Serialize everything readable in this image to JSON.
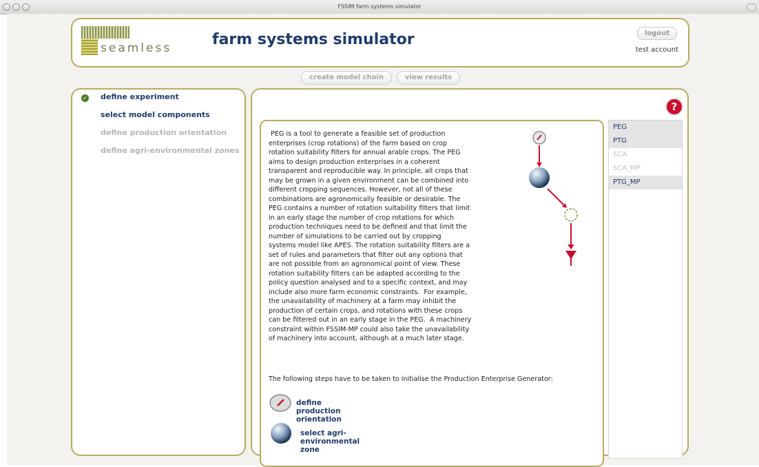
{
  "window": {
    "title": "FSSIM farm systems simulator"
  },
  "header": {
    "logo_text": "seamless",
    "app_title": "farm systems simulator",
    "logout_label": "logout",
    "account": "test account"
  },
  "toolbar": {
    "create_model_chain": "create model chain",
    "view_results": "view results"
  },
  "nav": {
    "items": [
      {
        "label": "define experiment",
        "state": "done"
      },
      {
        "label": "select model components",
        "state": "active"
      },
      {
        "label": "define production orientation",
        "state": "disabled"
      },
      {
        "label": "define agri-environmental zones",
        "state": "disabled"
      }
    ]
  },
  "main": {
    "description_lines": [
      " PEG is a tool to generate a feasible set of production",
      "enterprises (crop rotations) of the farm based on crop",
      "rotation suitability filters for annual arable crops. The PEG",
      "aims to design production enterprises in a coherent",
      "transparent and reproducible way. In principle, all crops that",
      "may be grown in a given environment can be combined into",
      "different cropping sequences. However, not all of these",
      "combinations are agronomically feasible or desirable. The",
      "PEG contains a number of rotation suitability filters that limit",
      "in an early stage the number of crop rotations for which",
      "production techniques need to be defined and that limit the",
      "number of simulations to be carried out by cropping",
      "systems model like APES. The rotation suitability filters are a",
      "set of rules and parameters that filter out any options that",
      "are not possible from an agronomical point of view. These",
      "rotation suitability filters can be adapted according to the",
      "policy question analysed and to a specific context, and may",
      "include also more farm economic constraints.  For example,",
      "the unavailability of machinery at a farm may inhibit the",
      "production of certain crops, and rotations with these crops",
      "can be filtered out in an early stage in the PEG.  A machinery",
      "constraint within FSSIM-MP could also take the unavailability",
      "of machinery into account, although at a much later stage."
    ],
    "steps_intro": "The following steps have to be taken to initialise the Production Enterprise Generator:",
    "steps": [
      {
        "label": "define production orientation",
        "icon": "compass-icon"
      },
      {
        "label": "select agri-environmental zone",
        "icon": "globe-icon"
      }
    ]
  },
  "components": {
    "items": [
      {
        "label": "PEG",
        "state": "selected"
      },
      {
        "label": "PTG",
        "state": "selected"
      },
      {
        "label": "SCA",
        "state": "disabled"
      },
      {
        "label": "SCA_MP",
        "state": "disabled"
      },
      {
        "label": "PTG_MP",
        "state": "selected"
      }
    ]
  },
  "colors": {
    "accent_gold": "#b9ab5f",
    "title_blue": "#1f3c6b",
    "help_red": "#c8102e",
    "check_green": "#4e7a26"
  }
}
